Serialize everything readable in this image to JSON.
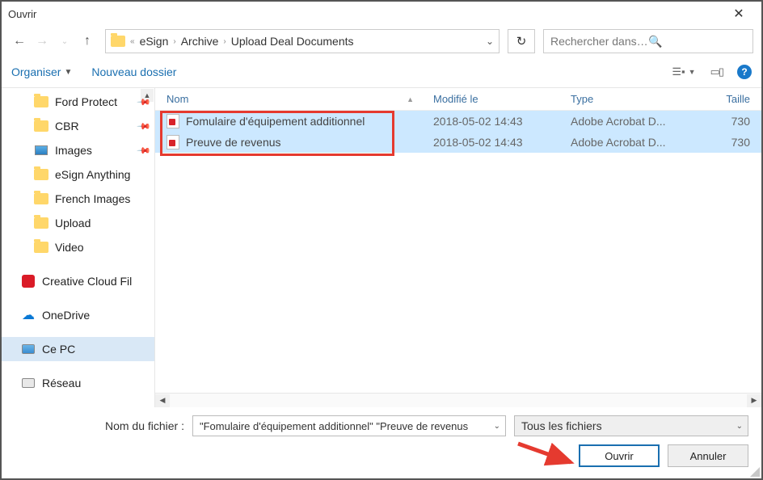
{
  "title": "Ouvrir",
  "breadcrumbs": [
    "eSign",
    "Archive",
    "Upload Deal Documents"
  ],
  "search_placeholder": "Rechercher dans : Upload Dea...",
  "toolbar": {
    "organize": "Organiser",
    "new_folder": "Nouveau dossier"
  },
  "sidebar": {
    "pinned": [
      {
        "label": "Ford Protect",
        "pin": true,
        "icon": "folder"
      },
      {
        "label": "CBR",
        "pin": true,
        "icon": "folder"
      },
      {
        "label": "Images",
        "pin": true,
        "icon": "images"
      },
      {
        "label": "eSign Anything",
        "pin": false,
        "icon": "folder"
      },
      {
        "label": "French Images",
        "pin": false,
        "icon": "folder"
      },
      {
        "label": "Upload",
        "pin": false,
        "icon": "folder"
      },
      {
        "label": "Video",
        "pin": false,
        "icon": "folder"
      }
    ],
    "groups": [
      {
        "label": "Creative Cloud Fil",
        "icon": "cc"
      },
      {
        "label": "OneDrive",
        "icon": "onedrive"
      },
      {
        "label": "Ce PC",
        "icon": "pc",
        "selected": true
      },
      {
        "label": "Réseau",
        "icon": "network"
      }
    ]
  },
  "columns": {
    "name": "Nom",
    "modified": "Modifié le",
    "type": "Type",
    "size": "Taille"
  },
  "files": [
    {
      "name": "Fomulaire d'équipement additionnel",
      "modified": "2018-05-02 14:43",
      "type": "Adobe Acrobat D...",
      "size": "730"
    },
    {
      "name": "Preuve de revenus",
      "modified": "2018-05-02 14:43",
      "type": "Adobe Acrobat D...",
      "size": "730"
    }
  ],
  "footer": {
    "filename_label": "Nom du fichier :",
    "filename_value": "\"Fomulaire d'équipement additionnel\" \"Preuve de revenus",
    "filter": "Tous les fichiers",
    "open": "Ouvrir",
    "cancel": "Annuler"
  },
  "annotation": {
    "arrow_color": "#e53a2f"
  }
}
